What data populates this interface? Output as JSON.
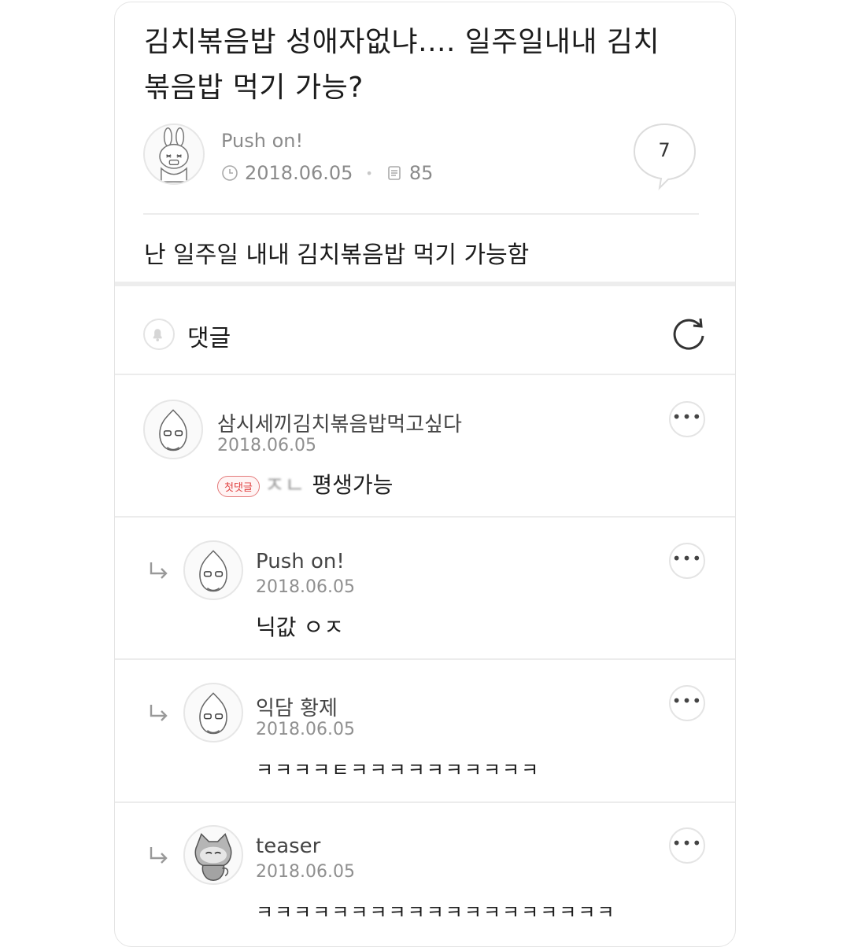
{
  "post": {
    "title_line1": "김치볶음밥 성애자없냐.... 일주일내내 김치",
    "title_line2": "볶음밥 먹기 가능?",
    "author": "Push on!",
    "date": "2018.06.05",
    "views": "85",
    "comment_count": "7",
    "body": "난 일주일 내내 김치볶음밥 먹기 가능함"
  },
  "comments_header": {
    "label": "댓글"
  },
  "comments": [
    {
      "name": "삼시세끼김치볶음밥먹고싶다",
      "date": "2018.06.05",
      "badge": "첫댓글",
      "text_blur": "ㅈㄴ",
      "text": "평생가능",
      "more": "•••"
    },
    {
      "name": "Push on!",
      "date": "2018.06.05",
      "text": "닉값 ㅇㅈ",
      "more": "•••"
    },
    {
      "name": "익담 황제",
      "date": "2018.06.05",
      "text": "ㅋㅋㅋㅋㅌㅋㅋㅋㅋㅋㅋㅋㅋㅋㅋ",
      "more": "•••"
    },
    {
      "name": "teaser",
      "date": "2018.06.05",
      "text": "ㅋㅋㅋㅋㅋㅋㅋㅋㅋㅋㅋㅋㅋㅋㅋㅋㅋㅋㅋ",
      "more": "•••"
    }
  ]
}
